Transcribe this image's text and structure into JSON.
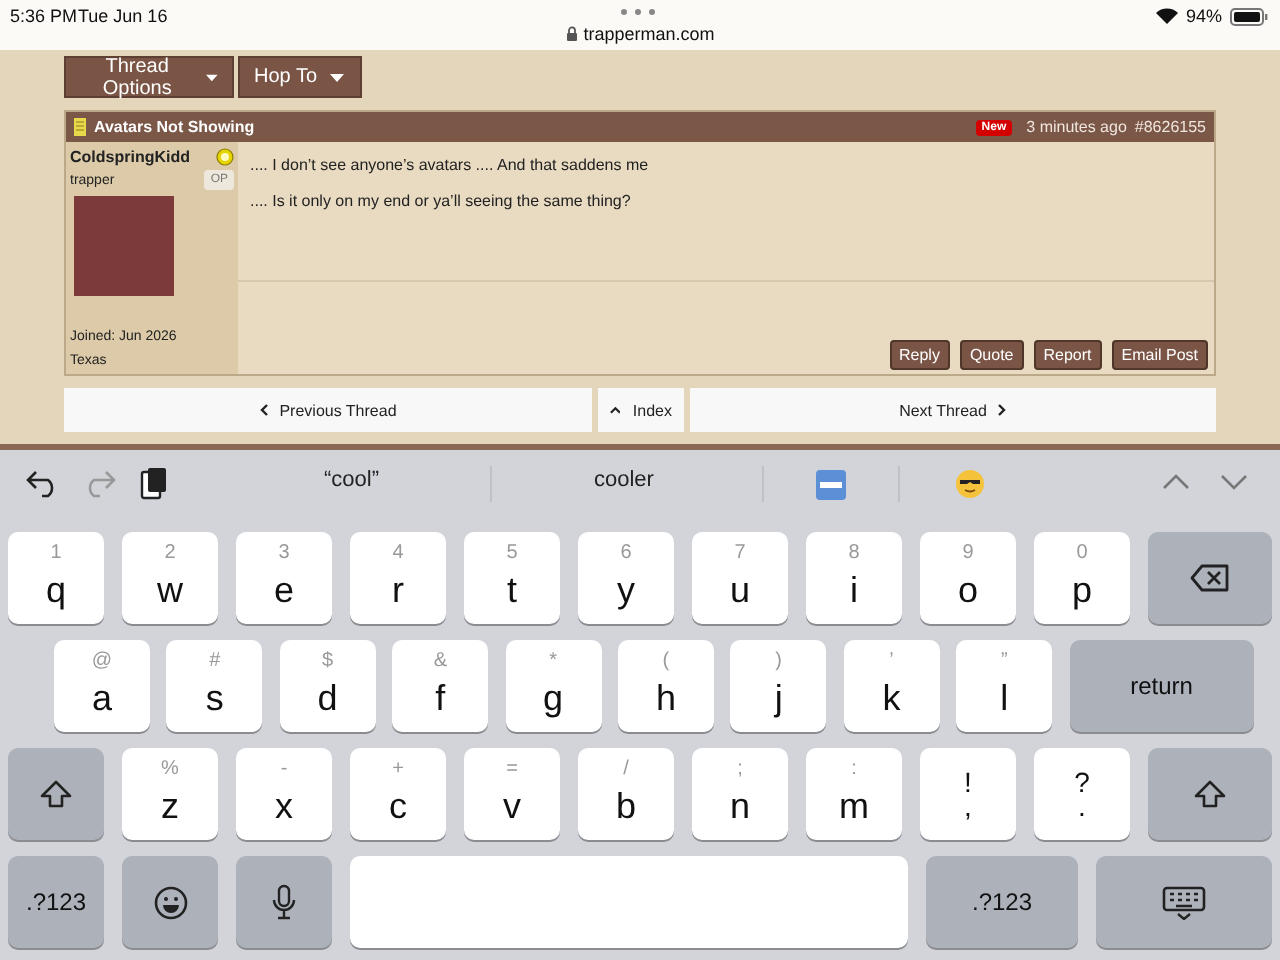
{
  "status_bar": {
    "time": "5:36 PM",
    "date": "Tue Jun 16",
    "battery": "94%",
    "url": "trapperman.com"
  },
  "toolbar": [
    {
      "label": "Thread Options"
    },
    {
      "label": "Hop To"
    }
  ],
  "post": {
    "title": "Avatars Not Showing",
    "badge": "New",
    "time": "3 minutes ago",
    "number": "#8626155",
    "author": {
      "name": "ColdspringKidd",
      "rank": "trapper",
      "op_badge": "OP",
      "joined": "Joined: Jun 2026",
      "location": "Texas"
    },
    "paragraphs": [
      ".... I don’t see anyone’s avatars .... And that saddens me",
      ".... Is it only on my end or ya’ll seeing the same thing?"
    ],
    "actions": [
      "Reply",
      "Quote",
      "Report",
      "Email Post"
    ]
  },
  "thread_nav": {
    "previous": "Previous Thread",
    "index": "Index",
    "next": "Next Thread"
  },
  "keyboard": {
    "suggestions": [
      "“cool”",
      "cooler"
    ],
    "rows": [
      [
        {
          "kind": "letter",
          "label": "q",
          "alt": "1"
        },
        {
          "kind": "letter",
          "label": "w",
          "alt": "2"
        },
        {
          "kind": "letter",
          "label": "e",
          "alt": "3"
        },
        {
          "kind": "letter",
          "label": "r",
          "alt": "4"
        },
        {
          "kind": "letter",
          "label": "t",
          "alt": "5"
        },
        {
          "kind": "letter",
          "label": "y",
          "alt": "6"
        },
        {
          "kind": "letter",
          "label": "u",
          "alt": "7"
        },
        {
          "kind": "letter",
          "label": "i",
          "alt": "8"
        },
        {
          "kind": "letter",
          "label": "o",
          "alt": "9"
        },
        {
          "kind": "letter",
          "label": "p",
          "alt": "0"
        },
        {
          "kind": "backspace"
        }
      ],
      [
        {
          "kind": "letter",
          "label": "a",
          "alt": "@"
        },
        {
          "kind": "letter",
          "label": "s",
          "alt": "#"
        },
        {
          "kind": "letter",
          "label": "d",
          "alt": "$"
        },
        {
          "kind": "letter",
          "label": "f",
          "alt": "&"
        },
        {
          "kind": "letter",
          "label": "g",
          "alt": "*"
        },
        {
          "kind": "letter",
          "label": "h",
          "alt": "("
        },
        {
          "kind": "letter",
          "label": "j",
          "alt": ")"
        },
        {
          "kind": "letter",
          "label": "k",
          "alt": "’"
        },
        {
          "kind": "letter",
          "label": "l",
          "alt": "”"
        },
        {
          "kind": "return",
          "label": "return"
        }
      ],
      [
        {
          "kind": "shift"
        },
        {
          "kind": "letter",
          "label": "z",
          "alt": "%"
        },
        {
          "kind": "letter",
          "label": "x",
          "alt": "-"
        },
        {
          "kind": "letter",
          "label": "c",
          "alt": "+"
        },
        {
          "kind": "letter",
          "label": "v",
          "alt": "="
        },
        {
          "kind": "letter",
          "label": "b",
          "alt": "/"
        },
        {
          "kind": "letter",
          "label": "n",
          "alt": ";"
        },
        {
          "kind": "letter",
          "label": "m",
          "alt": ":"
        },
        {
          "kind": "punct",
          "label": ",",
          "alt": "!"
        },
        {
          "kind": "punct",
          "label": ".",
          "alt": "?"
        },
        {
          "kind": "shift"
        }
      ],
      [
        {
          "kind": "numbers",
          "label": ".?123"
        },
        {
          "kind": "emoji"
        },
        {
          "kind": "mic"
        },
        {
          "kind": "space"
        },
        {
          "kind": "numbers",
          "label": ".?123"
        },
        {
          "kind": "dismiss"
        }
      ]
    ]
  }
}
